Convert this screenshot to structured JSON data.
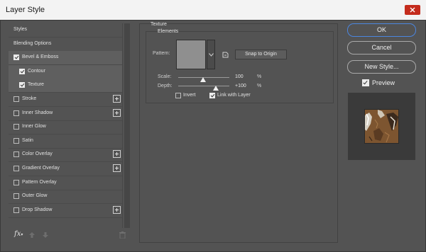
{
  "window": {
    "title": "Layer Style"
  },
  "styles_list": {
    "items": [
      {
        "label": "Styles",
        "has_checkbox": false,
        "checked": false,
        "has_add": false,
        "indent": false,
        "active": false
      },
      {
        "label": "Blending Options",
        "has_checkbox": false,
        "checked": false,
        "has_add": false,
        "indent": false,
        "active": false
      },
      {
        "label": "Bevel & Emboss",
        "has_checkbox": true,
        "checked": true,
        "has_add": false,
        "indent": false,
        "active": true
      },
      {
        "label": "Contour",
        "has_checkbox": true,
        "checked": true,
        "has_add": false,
        "indent": true,
        "active": true
      },
      {
        "label": "Texture",
        "has_checkbox": true,
        "checked": true,
        "has_add": false,
        "indent": true,
        "active": true
      },
      {
        "label": "Stroke",
        "has_checkbox": true,
        "checked": false,
        "has_add": true,
        "indent": false,
        "active": false
      },
      {
        "label": "Inner Shadow",
        "has_checkbox": true,
        "checked": false,
        "has_add": true,
        "indent": false,
        "active": false
      },
      {
        "label": "Inner Glow",
        "has_checkbox": true,
        "checked": false,
        "has_add": false,
        "indent": false,
        "active": false
      },
      {
        "label": "Satin",
        "has_checkbox": true,
        "checked": false,
        "has_add": false,
        "indent": false,
        "active": false
      },
      {
        "label": "Color Overlay",
        "has_checkbox": true,
        "checked": false,
        "has_add": true,
        "indent": false,
        "active": false
      },
      {
        "label": "Gradient Overlay",
        "has_checkbox": true,
        "checked": false,
        "has_add": true,
        "indent": false,
        "active": false
      },
      {
        "label": "Pattern Overlay",
        "has_checkbox": true,
        "checked": false,
        "has_add": false,
        "indent": false,
        "active": false
      },
      {
        "label": "Outer Glow",
        "has_checkbox": true,
        "checked": false,
        "has_add": false,
        "indent": false,
        "active": false
      },
      {
        "label": "Drop Shadow",
        "has_checkbox": true,
        "checked": false,
        "has_add": true,
        "indent": false,
        "active": false
      }
    ],
    "footer": {
      "fx_label": "fx",
      "icons": [
        "arrow-up-icon",
        "arrow-down-icon",
        "trash-icon"
      ]
    }
  },
  "texture_panel": {
    "group_title": "Texture",
    "subgroup_title": "Elements",
    "pattern_label": "Pattern:",
    "snap_button": "Snap to Origin",
    "scale_label": "Scale:",
    "scale_value": "100",
    "scale_unit": "%",
    "depth_label": "Depth:",
    "depth_value": "+100",
    "depth_unit": "%",
    "invert_label": "Invert",
    "invert_checked": false,
    "link_label": "Link with Layer",
    "link_checked": true
  },
  "actions": {
    "ok": "OK",
    "cancel": "Cancel",
    "new_style": "New Style...",
    "preview_label": "Preview",
    "preview_checked": true
  },
  "colors": {
    "dialog_bg": "#535353",
    "active_item": "#5f5f5f",
    "accent": "#4b86e0",
    "title_bar": "#f3f3f3",
    "close_button": "#c42b1c"
  }
}
